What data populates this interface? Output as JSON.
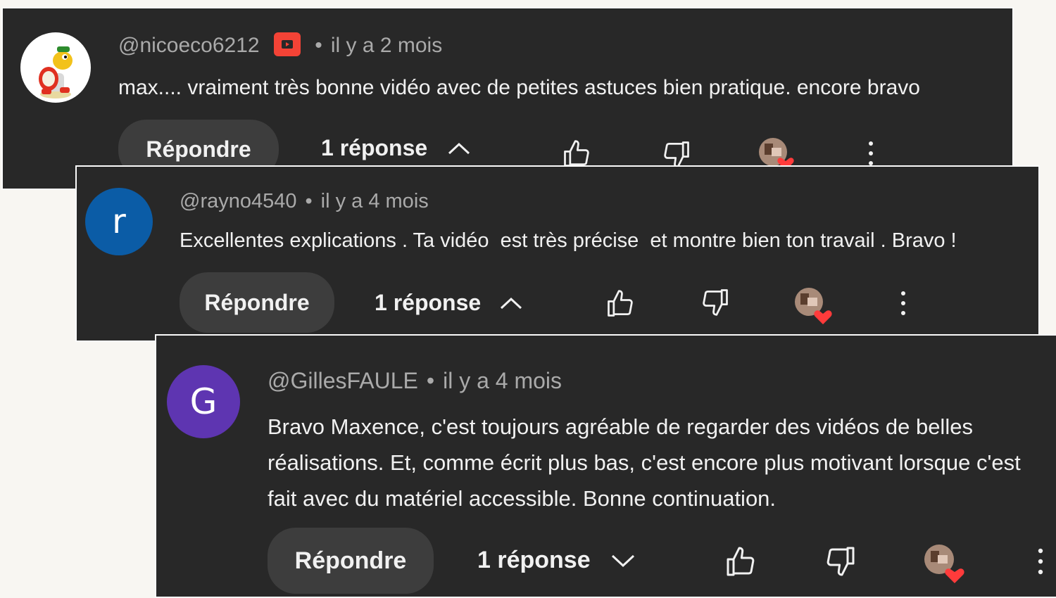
{
  "comments": [
    {
      "author": "@nicoeco6212",
      "time": "il y a 2 mois",
      "text": "max.... vraiment très bonne vidéo avec de petites astuces bien pratique. encore bravo",
      "reply_label": "Répondre",
      "replies_label": "1 réponse",
      "avatar_letter": "",
      "avatar_icon": "red-shell-koopa",
      "replies_expanded": true
    },
    {
      "author": "@rayno4540",
      "time": "il y a 4 mois",
      "text": "Excellentes explications . Ta vidéo  est très précise  et montre bien ton travail . Bravo !",
      "reply_label": "Répondre",
      "replies_label": "1 réponse",
      "avatar_letter": "r",
      "avatar_color": "#0b5ca6",
      "replies_expanded": true
    },
    {
      "author": "@GillesFAULE",
      "time": "il y a 4 mois",
      "text": "Bravo Maxence, c'est toujours agréable de regarder des vidéos de belles réalisations. Et, comme écrit plus bas, c'est encore plus motivant lorsque c'est fait avec du matériel accessible. Bonne continuation.",
      "reply_label": "Répondre",
      "replies_label": "1 réponse",
      "avatar_letter": "G",
      "avatar_color": "#5e35b1",
      "replies_expanded": false
    }
  ],
  "colors": {
    "background": "#f8f6f2",
    "card": "#282828",
    "meta_text": "#aaaaaa",
    "body_text": "#f1f1f1",
    "button": "#3d3d3d",
    "heart": "#ff3b3b",
    "member_badge": "#f44336"
  },
  "icons": {
    "like": "thumbs-up-icon",
    "dislike": "thumbs-down-icon",
    "creator_heart": "creator-heart-icon",
    "more": "more-vert-icon",
    "chevron_up": "chevron-up-icon",
    "chevron_down": "chevron-down-icon",
    "member_badge": "member-badge-icon"
  }
}
